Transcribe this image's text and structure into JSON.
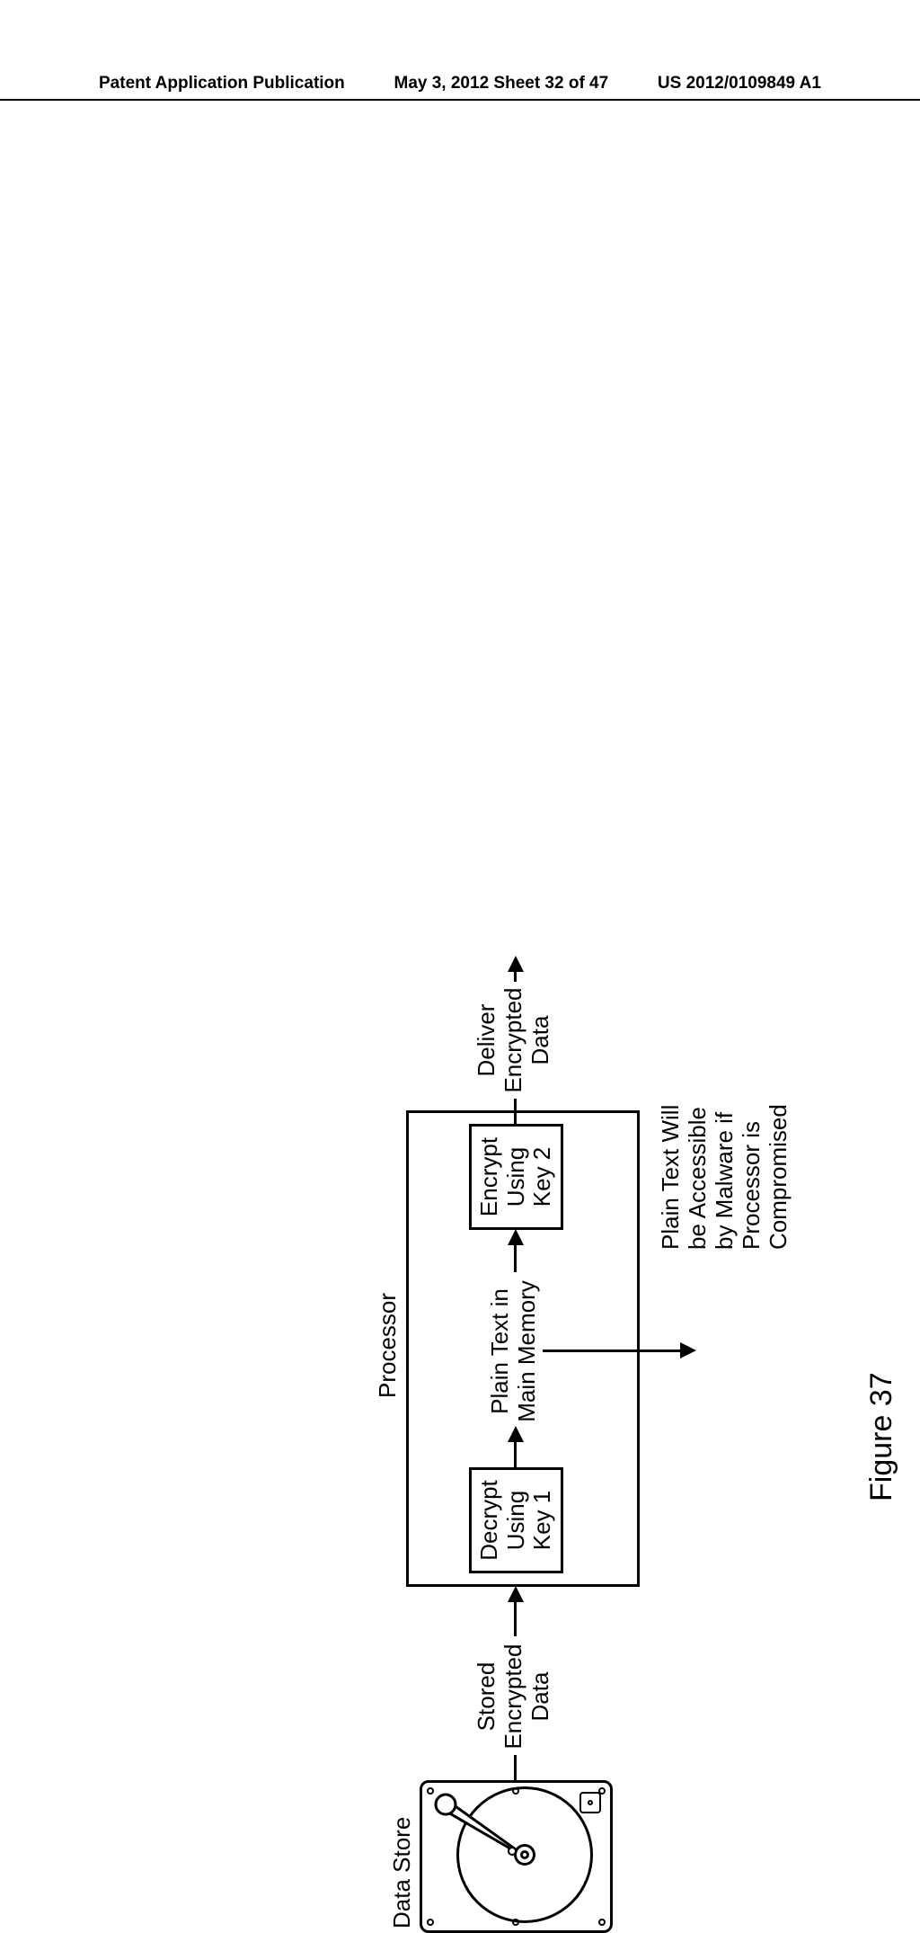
{
  "header": {
    "left": "Patent Application Publication",
    "center": "May 3, 2012  Sheet 32 of 47",
    "right": "US 2012/0109849 A1"
  },
  "labels": {
    "data_store": "Data Store",
    "processor": "Processor",
    "stored_encrypted_data_l1": "Stored",
    "stored_encrypted_data_l2": "Encrypted",
    "stored_encrypted_data_l3": "Data",
    "decrypt_l1": "Decrypt",
    "decrypt_l2": "Using",
    "decrypt_l3": "Key 1",
    "plaintext_l1": "Plain Text in",
    "plaintext_l2": "Main Memory",
    "encrypt_l1": "Encrypt",
    "encrypt_l2": "Using",
    "encrypt_l3": "Key 2",
    "deliver_l1": "Deliver",
    "deliver_l2": "Encrypted",
    "deliver_l3": "Data",
    "warning_l1": "Plain Text Will",
    "warning_l2": "be Accessible",
    "warning_l3": "by Malware if",
    "warning_l4": "Processor is",
    "warning_l5": "Compromised",
    "figure": "Figure 37"
  }
}
